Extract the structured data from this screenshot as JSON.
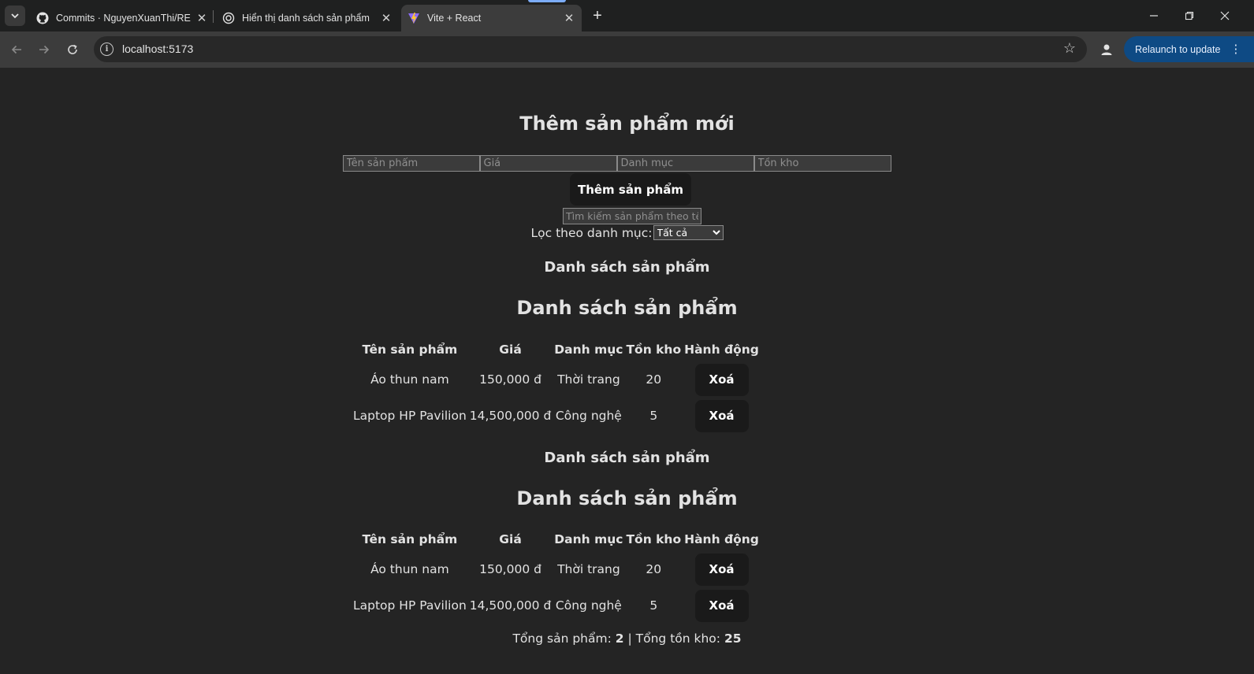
{
  "browser": {
    "tabs": [
      {
        "title": "Commits · NguyenXuanThi/REA",
        "icon": "github-icon"
      },
      {
        "title": "Hiển thị danh sách sản phẩm",
        "icon": "chatgpt-icon"
      },
      {
        "title": "Vite + React",
        "icon": "vite-icon",
        "active": true
      }
    ],
    "url": "localhost:5173",
    "relaunch_label": "Relaunch to update"
  },
  "form": {
    "title": "Thêm sản phẩm mới",
    "placeholders": {
      "name": "Tên sản phẩm",
      "price": "Giá",
      "category": "Danh mục",
      "stock": "Tồn kho"
    },
    "add_button": "Thêm sản phẩm",
    "search_placeholder": "Tìm kiếm sản phẩm theo tên",
    "filter_label": "Lọc theo danh mục:",
    "filter_selected": "Tất cả"
  },
  "lists": [
    {
      "small_title": "Danh sách sản phẩm",
      "big_title": "Danh sách sản phẩm",
      "headers": [
        "Tên sản phẩm",
        "Giá",
        "Danh mục",
        "Tồn kho",
        "Hành động"
      ],
      "rows": [
        {
          "name": "Áo thun nam",
          "price": "150,000 đ",
          "category": "Thời trang",
          "stock": "20",
          "action": "Xoá"
        },
        {
          "name": "Laptop HP Pavilion",
          "price": "14,500,000 đ",
          "category": "Công nghệ",
          "stock": "5",
          "action": "Xoá"
        }
      ]
    },
    {
      "small_title": "Danh sách sản phẩm",
      "big_title": "Danh sách sản phẩm",
      "headers": [
        "Tên sản phẩm",
        "Giá",
        "Danh mục",
        "Tồn kho",
        "Hành động"
      ],
      "rows": [
        {
          "name": "Áo thun nam",
          "price": "150,000 đ",
          "category": "Thời trang",
          "stock": "20",
          "action": "Xoá"
        },
        {
          "name": "Laptop HP Pavilion",
          "price": "14,500,000 đ",
          "category": "Công nghệ",
          "stock": "5",
          "action": "Xoá"
        }
      ]
    }
  ],
  "summary": {
    "total_label": "Tổng sản phẩm:",
    "total_value": "2",
    "separator": "|",
    "stock_label": "Tổng tồn kho:",
    "stock_value": "25"
  },
  "colors": {
    "background": "#242424",
    "button_bg": "#1a1a1a",
    "relaunch_bg": "#0e4a84"
  }
}
